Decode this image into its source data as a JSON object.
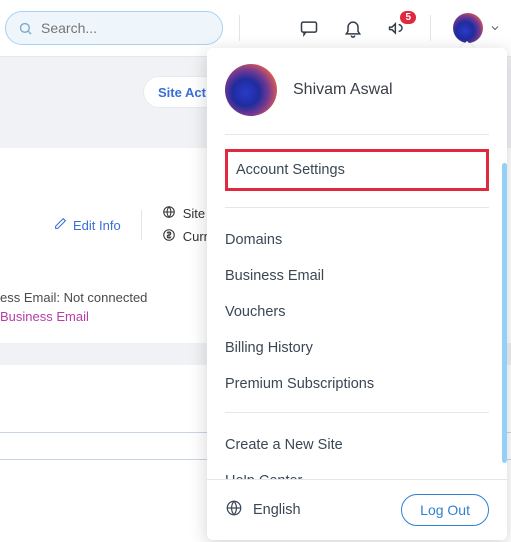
{
  "topbar": {
    "search_placeholder": "Search...",
    "notif_count": "5"
  },
  "bg": {
    "site_activity": "Site Act",
    "edit_info": "Edit Info",
    "site_label": "Site la",
    "currency_label": "Curre",
    "email_line1": "ess Email: Not connected",
    "email_line2": " Business Email"
  },
  "panel": {
    "user_name": "Shivam Aswal",
    "account_settings": "Account Settings",
    "items": [
      "Domains",
      "Business Email",
      "Vouchers",
      "Billing History",
      "Premium Subscriptions"
    ],
    "more": [
      "Create a New Site",
      "Help Center"
    ],
    "language": "English",
    "logout": "Log Out"
  }
}
